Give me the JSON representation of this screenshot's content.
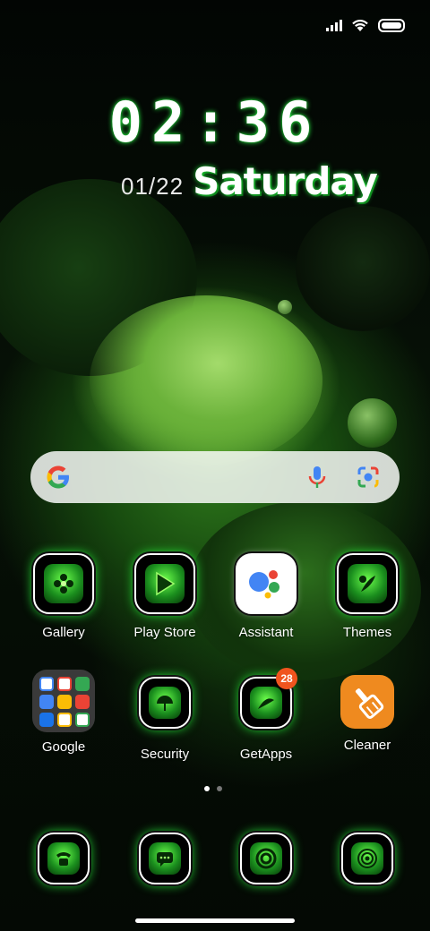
{
  "status_bar": {
    "signal_icon": "signal-icon",
    "wifi_icon": "wifi-icon",
    "battery_icon": "battery-icon"
  },
  "lock_widget": {
    "time": "02:36",
    "date": "01/22",
    "day": "Saturday"
  },
  "search_bar": {
    "logo": "google-g-icon",
    "mic": "mic-icon",
    "lens": "lens-icon"
  },
  "apps_row1": [
    {
      "label": "Gallery",
      "icon": "gallery-icon"
    },
    {
      "label": "Play Store",
      "icon": "play-store-icon"
    },
    {
      "label": "Assistant",
      "icon": "assistant-icon"
    },
    {
      "label": "Themes",
      "icon": "themes-icon"
    }
  ],
  "apps_row2": [
    {
      "label": "Google",
      "icon": "google-folder-icon"
    },
    {
      "label": "Security",
      "icon": "security-icon"
    },
    {
      "label": "GetApps",
      "icon": "getapps-icon",
      "badge": "28"
    },
    {
      "label": "Cleaner",
      "icon": "cleaner-icon"
    }
  ],
  "page_indicator": {
    "pages": 2,
    "active": 1
  },
  "dock": [
    {
      "icon": "phone-icon"
    },
    {
      "icon": "messages-icon"
    },
    {
      "icon": "browser-icon"
    },
    {
      "icon": "camera-icon"
    }
  ],
  "colors": {
    "glow": "#26ff3c",
    "badge": "#f0541e",
    "cleaner": "#ef8a1f"
  }
}
